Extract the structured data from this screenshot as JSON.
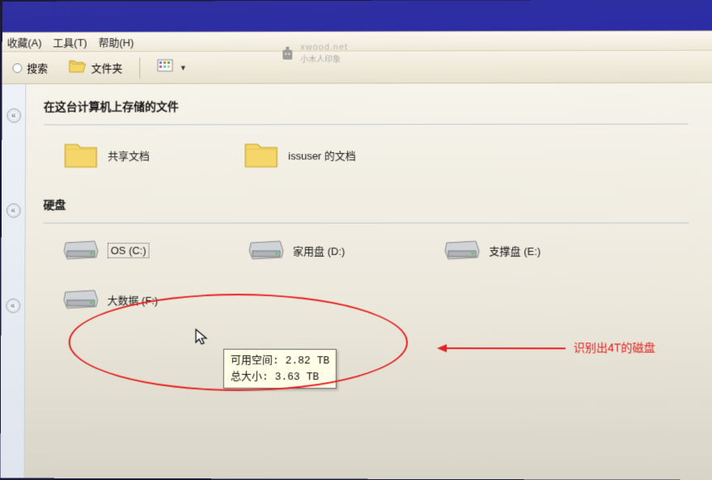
{
  "menubar": {
    "favorites": "收藏(A)",
    "tools": "工具(T)",
    "help": "帮助(H)"
  },
  "toolbar": {
    "search": "搜索",
    "folders": "文件夹"
  },
  "sections": {
    "files_stored": "在这台计算机上存储的文件",
    "drives": "硬盘"
  },
  "folders": {
    "shared": "共享文档",
    "user": "issuser 的文档"
  },
  "drives": {
    "c": "OS (C:)",
    "d": "家用盘 (D:)",
    "e": "支撑盘 (E:)",
    "f": "大数据 (F:)"
  },
  "tooltip": {
    "free_label": "可用空间:",
    "free_value": "2.82 TB",
    "total_label": "总大小:",
    "total_value": "3.63 TB"
  },
  "annotation": {
    "text": "识别出4T的磁盘"
  },
  "watermark": {
    "line1": "xwood.net",
    "line2": "小木人印象"
  }
}
